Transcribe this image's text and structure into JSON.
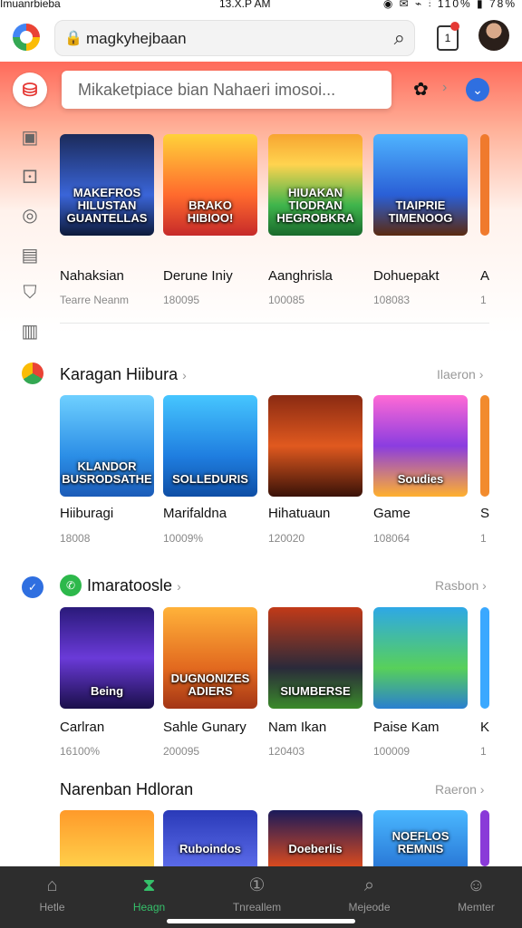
{
  "status": {
    "carrier": "Imuanrbieba",
    "time": "13.X.P AM",
    "right": "◉ ✉ ⌁ ⫶ 110% ▮ 78%"
  },
  "browser": {
    "url": "magkyhejbaan",
    "lock_icon": "lock-icon",
    "search_icon": "search-icon",
    "tabs_count": "1"
  },
  "search": {
    "placeholder": "Mikaketpiace bian Nahaeri imosoi..."
  },
  "sections": [
    {
      "title": "",
      "more": "",
      "games": [
        {
          "name": "Nahaksian",
          "sub": "Tearre Neanm",
          "art": "MAKEFROS HILUSTAN GUANTELLAS"
        },
        {
          "name": "Derune Iniy",
          "sub": "180095",
          "art": "BRAKO HIBIOO!"
        },
        {
          "name": "Aanghrisla",
          "sub": "100085",
          "art": "HIUAKAN TIODRAN HEGROBKRA"
        },
        {
          "name": "Dohuepakt",
          "sub": "108083",
          "art": "TIAIPRIE TIMENOOG"
        },
        {
          "name": "A",
          "sub": "1",
          "art": ""
        }
      ]
    },
    {
      "title": "Karagan Hiibura",
      "more": "Ilaeron",
      "games": [
        {
          "name": "Hiiburagi",
          "sub": "18008",
          "art": "KLANDOR BUSRODSATHE"
        },
        {
          "name": "Marifaldna",
          "sub": "10009%",
          "art": "SOLLEDURIS"
        },
        {
          "name": "Hihatuaun",
          "sub": "120020",
          "art": ""
        },
        {
          "name": "Game",
          "sub": "108064",
          "art": "Soudies"
        },
        {
          "name": "S",
          "sub": "1",
          "art": ""
        }
      ]
    },
    {
      "title": "Imaratoosle",
      "more": "Rasbon",
      "games": [
        {
          "name": "Carlran",
          "sub": "16100%",
          "art": "Being"
        },
        {
          "name": "Sahle Gunary",
          "sub": "200095",
          "art": "DUGNONIZES ADIERS"
        },
        {
          "name": "Nam Ikan",
          "sub": "120403",
          "art": "SIUMBERSE"
        },
        {
          "name": "Paise Kam",
          "sub": "100009",
          "art": ""
        },
        {
          "name": "K",
          "sub": "1",
          "art": ""
        }
      ]
    },
    {
      "title": "Narenban Hdloran",
      "more": "Raeron",
      "games": [
        {
          "name": "",
          "sub": "",
          "art": ""
        },
        {
          "name": "",
          "sub": "",
          "art": "Ruboindos"
        },
        {
          "name": "",
          "sub": "",
          "art": "Doeberlis"
        },
        {
          "name": "",
          "sub": "",
          "art": "NOEFLOS REMNIS"
        },
        {
          "name": "",
          "sub": "",
          "art": ""
        }
      ]
    }
  ],
  "side_icons": [
    "grid-icon",
    "game-icon",
    "target-icon",
    "chart-icon",
    "shield-icon",
    "book-icon"
  ],
  "nav": [
    {
      "label": "Hetle",
      "icon": "home-icon"
    },
    {
      "label": "Heagn",
      "icon": "hourglass-icon"
    },
    {
      "label": "Tnreallem",
      "icon": "clock-icon"
    },
    {
      "label": "Mejeode",
      "icon": "discover-icon"
    },
    {
      "label": "Memter",
      "icon": "profile-icon"
    }
  ]
}
